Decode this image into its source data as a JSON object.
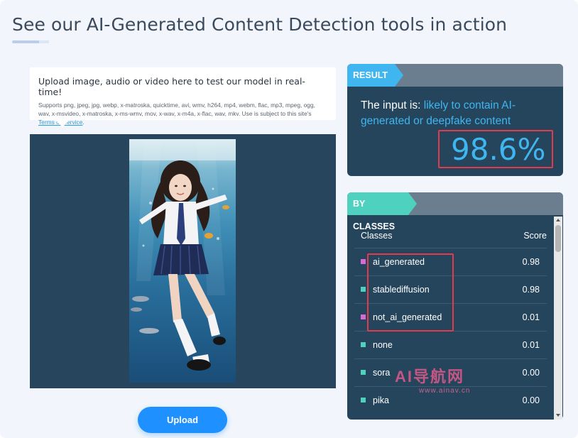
{
  "page": {
    "title": "See our AI-Generated Content Detection tools in action"
  },
  "upload_info": {
    "title": "Upload image, audio or video here to test our model in real-time!",
    "supports_text": "Supports png, jpeg, jpg, webp, x-matroska, quicktime, avi, wmv, h264, mp4, webm, flac, mp3, mpeg, ogg, wav, x-msvideo, x-matroska, x-ms-wmv, mov, x-wav, x-m4a, x-flac, wav, mkv. Use is subject to this site's",
    "terms_link": "Terms of Service",
    "terms_suffix": "."
  },
  "preview": {
    "image_name": "uploaded-photo"
  },
  "upload_button": {
    "label": "Upload"
  },
  "result": {
    "tag": "RESULT",
    "prefix": "The input is: ",
    "verdict": "likely to contain AI-generated or deepfake content",
    "score": "98.6%"
  },
  "classes": {
    "tag": "BY CLASSES",
    "col_class": "Classes",
    "col_score": "Score",
    "rows": [
      {
        "name": "ai_generated",
        "score": "0.98",
        "color": "#d96bd6"
      },
      {
        "name": "stablediffusion",
        "score": "0.98",
        "color": "#4fd1c0"
      },
      {
        "name": "not_ai_generated",
        "score": "0.01",
        "color": "#d96bd6"
      },
      {
        "name": "none",
        "score": "0.01",
        "color": "#4fd1c0"
      },
      {
        "name": "sora",
        "score": "0.00",
        "color": "#4fd1c0"
      },
      {
        "name": "pika",
        "score": "0.00",
        "color": "#4fd1c0"
      }
    ]
  },
  "watermark": {
    "main": "AI导航网",
    "sub": "www.ainav.cn"
  },
  "colors": {
    "accent": "#3fb6ef",
    "card_bg": "#25455d",
    "highlight": "#e23b4e",
    "button": "#1e90ff"
  }
}
